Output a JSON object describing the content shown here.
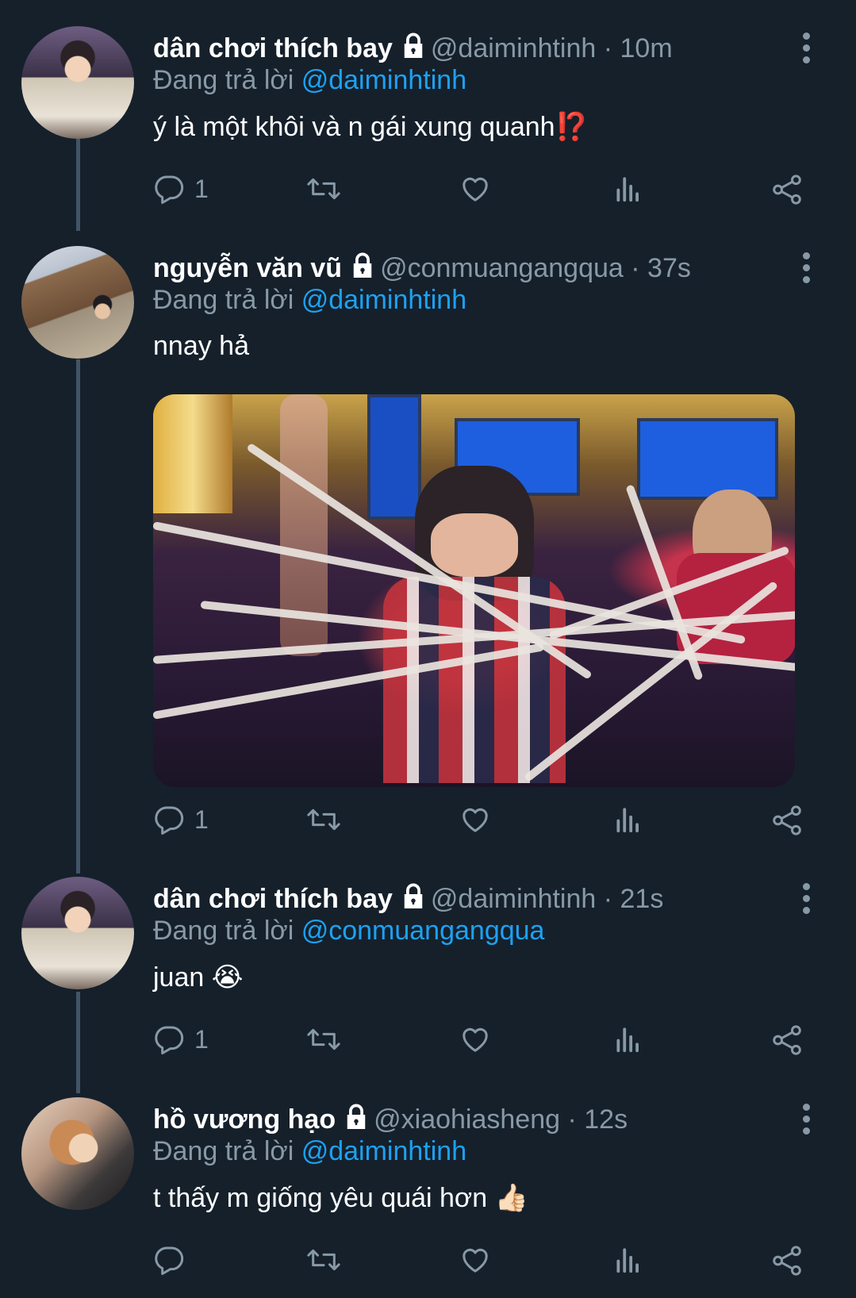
{
  "tweets": [
    {
      "display_name": "dân chơi thích bay",
      "handle": "@daiminhtinh",
      "time": "10m",
      "replying_label": "Đang trả lời ",
      "replying_to": "@daiminhtinh",
      "text": "ý là một khôi và n gái xung quanh⁉️",
      "reply_count": "1",
      "retweet_count": "",
      "like_count": "",
      "avatar_icon": "avatar-photo"
    },
    {
      "display_name": "nguyễn văn vũ",
      "handle": "@conmuangangqua",
      "time": "37s",
      "replying_label": "Đang trả lời ",
      "replying_to": "@daiminhtinh",
      "text": "nnay hả",
      "reply_count": "1",
      "retweet_count": "",
      "like_count": "",
      "avatar_icon": "avatar-photo"
    },
    {
      "display_name": "dân chơi thích bay",
      "handle": "@daiminhtinh",
      "time": "21s",
      "replying_label": "Đang trả lời ",
      "replying_to": "@conmuangangqua",
      "text": "juan 😭",
      "reply_count": "1",
      "retweet_count": "",
      "like_count": "",
      "avatar_icon": "avatar-photo"
    },
    {
      "display_name": "hồ vương hạo",
      "handle": "@xiaohiasheng",
      "time": "12s",
      "replying_label": "Đang trả lời ",
      "replying_to": "@daiminhtinh",
      "text": "t thấy m giống yêu quái hơn 👍🏻",
      "reply_count": "",
      "retweet_count": "",
      "like_count": "",
      "avatar_icon": "avatar-photo"
    }
  ],
  "colors": {
    "background": "#15202b",
    "muted": "#8899a6",
    "accent": "#1da1f2",
    "thread_line": "#425466"
  },
  "icons": [
    "lock-icon",
    "more-icon",
    "reply-icon",
    "retweet-icon",
    "like-icon",
    "analytics-icon",
    "share-icon"
  ]
}
